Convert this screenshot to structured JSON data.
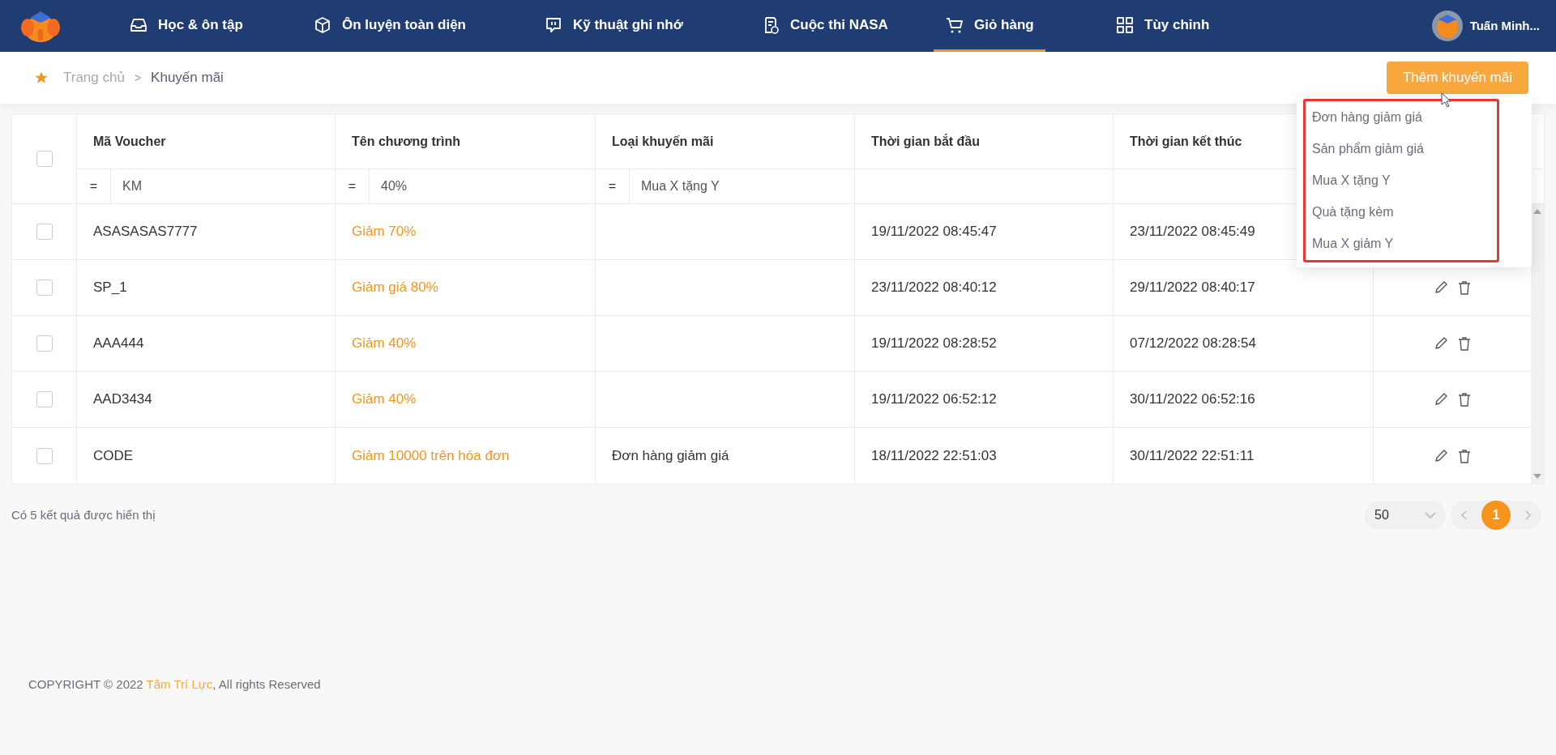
{
  "nav": {
    "items": [
      {
        "label": "Học & ôn tập",
        "selected": false
      },
      {
        "label": "Ôn luyện toàn diện",
        "selected": false
      },
      {
        "label": "Kỹ thuật ghi nhớ",
        "selected": false
      },
      {
        "label": "Cuộc thi NASA",
        "selected": false
      },
      {
        "label": "Giỏ hàng",
        "selected": true
      },
      {
        "label": "Tùy chỉnh",
        "selected": false
      }
    ],
    "user": {
      "name": "Tuấn Minh..."
    }
  },
  "breadcrumb": [
    "Trang chủ",
    ">",
    "Khuyến mãi"
  ],
  "add_button": "Thêm khuyến mãi",
  "dropdown": {
    "options": [
      "Đơn hàng giảm giá",
      "Sản phẩm giảm giá",
      "Mua X tặng Y",
      "Quà tặng kèm",
      "Mua X giảm Y"
    ]
  },
  "table": {
    "select_all": {
      "checked": false
    },
    "columns": [
      "Mã Voucher",
      "Tên chương trình",
      "Loại khuyến mãi",
      "Thời gian bắt đầu",
      "Thời gian kết thúc"
    ],
    "filters": [
      {
        "operator": "=",
        "value": "KM"
      },
      {
        "operator": "=",
        "value": "40%"
      },
      {
        "operator": "=",
        "value": "Mua X tặng Y"
      }
    ],
    "rows": [
      {
        "checked": false,
        "code": "ASASASAS7777",
        "name": "Giảm 70%",
        "start": "19/11/2022 08:45:47",
        "end": "23/11/2022 08:45:49"
      },
      {
        "checked": false,
        "code": "SP_1",
        "name": "Giảm giá 80%",
        "start": "23/11/2022 08:40:12",
        "end": "29/11/2022 08:40:17",
        "actions": true
      },
      {
        "checked": false,
        "code": "AAA444",
        "name": "Giảm 40%",
        "start": "19/11/2022 08:28:52",
        "end": "07/12/2022 08:28:54",
        "actions": true
      },
      {
        "checked": false,
        "code": "AAD3434",
        "name": "Giảm 40%",
        "start": "19/11/2022 06:52:12",
        "end": "30/11/2022 06:52:16",
        "actions": true
      },
      {
        "checked": false,
        "code": "CODE",
        "name": "Giảm 10000 trên hóa đơn",
        "type": "Đơn hàng giảm giá",
        "start": "18/11/2022 22:51:03",
        "end": "30/11/2022 22:51:11",
        "actions": true
      }
    ]
  },
  "result_count": "Có 5 kết quả được hiển thị",
  "pagination": {
    "page_size": "50",
    "pages": [
      {
        "label": "1",
        "selected": true
      }
    ]
  },
  "footer": {
    "prefix": "COPYRIGHT © 2022 ",
    "link": "Tâm Trí Lực",
    "suffix": ", All rights Reserved"
  }
}
